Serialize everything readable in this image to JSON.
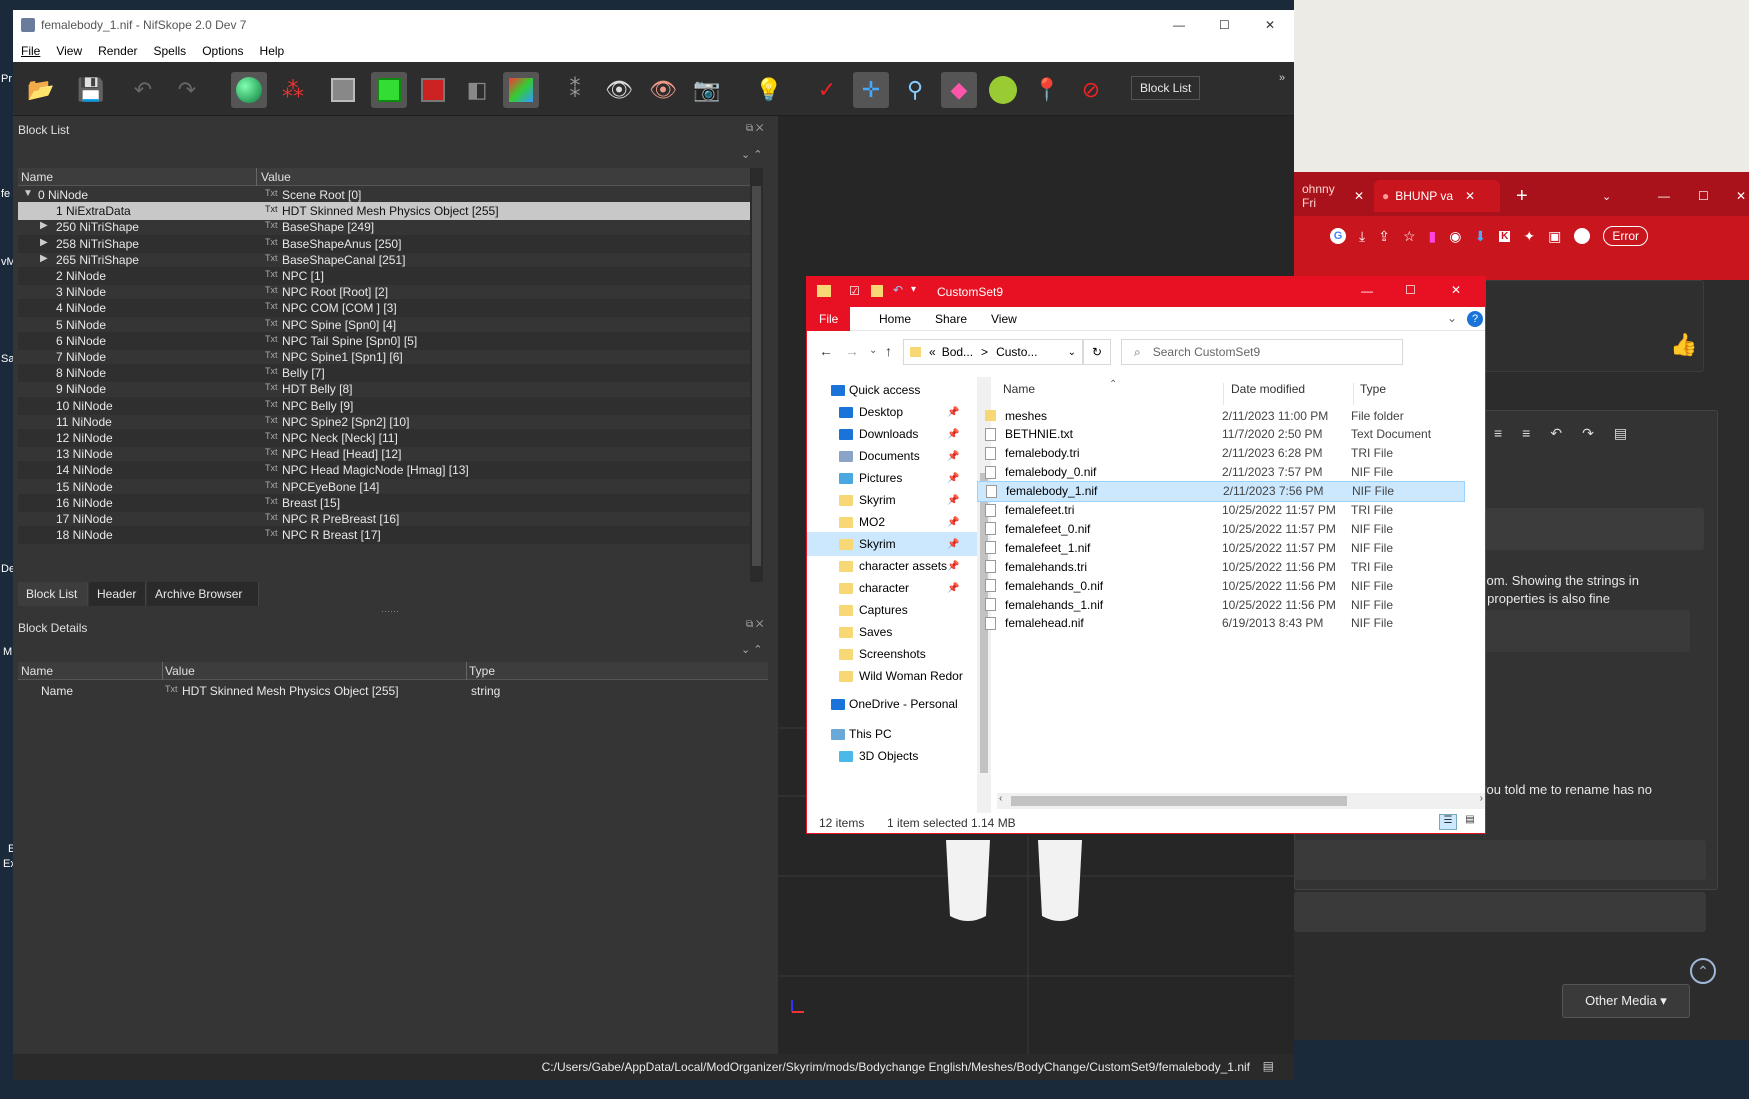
{
  "desktop": {
    "labels": [
      "Pr",
      "fe",
      "vM",
      "Sa",
      "De",
      "M",
      "E",
      "Ex"
    ]
  },
  "browser": {
    "tabs": [
      "ohnny Fri",
      "BHUNP va"
    ],
    "error_label": "Error",
    "text1_line1": "ndom. Showing the strings in",
    "text1_line2": "ar properties is also fine",
    "text2": "you told me to rename has no",
    "other_media": "Other Media ▾"
  },
  "nifskope": {
    "title": "femalebody_1.nif - NifSkope 2.0 Dev 7",
    "menu": [
      "File",
      "View",
      "Render",
      "Spells",
      "Options",
      "Help"
    ],
    "block_list_button": "Block List",
    "block_list_title": "Block List",
    "columns": {
      "name": "Name",
      "value": "Value"
    },
    "rows": [
      {
        "name": "0 NiNode",
        "value": "Scene Root [0]",
        "indent": 0,
        "arrow": "down"
      },
      {
        "name": "1 NiExtraData",
        "value": "HDT Skinned Mesh Physics Object [255]",
        "indent": 1,
        "arrow": "",
        "selected": true,
        "tag": "Txt"
      },
      {
        "name": "250 NiTriShape",
        "value": "BaseShape [249]",
        "indent": 1,
        "arrow": "right"
      },
      {
        "name": "258 NiTriShape",
        "value": "BaseShapeAnus [250]",
        "indent": 1,
        "arrow": "right"
      },
      {
        "name": "265 NiTriShape",
        "value": "BaseShapeCanal [251]",
        "indent": 1,
        "arrow": "right"
      },
      {
        "name": "2 NiNode",
        "value": "NPC [1]",
        "indent": 1,
        "arrow": ""
      },
      {
        "name": "3 NiNode",
        "value": "NPC Root [Root] [2]",
        "indent": 1,
        "arrow": ""
      },
      {
        "name": "4 NiNode",
        "value": "NPC COM [COM ] [3]",
        "indent": 1,
        "arrow": ""
      },
      {
        "name": "5 NiNode",
        "value": "NPC Spine [Spn0] [4]",
        "indent": 1,
        "arrow": ""
      },
      {
        "name": "6 NiNode",
        "value": "NPC Tail Spine [Spn0] [5]",
        "indent": 1,
        "arrow": ""
      },
      {
        "name": "7 NiNode",
        "value": "NPC Spine1 [Spn1] [6]",
        "indent": 1,
        "arrow": ""
      },
      {
        "name": "8 NiNode",
        "value": "Belly [7]",
        "indent": 1,
        "arrow": ""
      },
      {
        "name": "9 NiNode",
        "value": "HDT Belly [8]",
        "indent": 1,
        "arrow": ""
      },
      {
        "name": "10 NiNode",
        "value": "NPC Belly [9]",
        "indent": 1,
        "arrow": ""
      },
      {
        "name": "11 NiNode",
        "value": "NPC Spine2 [Spn2] [10]",
        "indent": 1,
        "arrow": ""
      },
      {
        "name": "12 NiNode",
        "value": "NPC Neck [Neck] [11]",
        "indent": 1,
        "arrow": ""
      },
      {
        "name": "13 NiNode",
        "value": "NPC Head [Head] [12]",
        "indent": 1,
        "arrow": ""
      },
      {
        "name": "14 NiNode",
        "value": "NPC Head MagicNode [Hmag] [13]",
        "indent": 1,
        "arrow": ""
      },
      {
        "name": "15 NiNode",
        "value": "NPCEyeBone [14]",
        "indent": 1,
        "arrow": ""
      },
      {
        "name": "16 NiNode",
        "value": "Breast [15]",
        "indent": 1,
        "arrow": ""
      },
      {
        "name": "17 NiNode",
        "value": "NPC R PreBreast [16]",
        "indent": 1,
        "arrow": ""
      },
      {
        "name": "18 NiNode",
        "value": "NPC R Breast [17]",
        "indent": 1,
        "arrow": ""
      }
    ],
    "row_tag": "Txt",
    "bottom_tabs": [
      "Block List",
      "Header",
      "Archive Browser"
    ],
    "block_details_title": "Block Details",
    "details_columns": {
      "name": "Name",
      "value": "Value",
      "type": "Type"
    },
    "details_row": {
      "name": "Name",
      "value": "HDT Skinned Mesh Physics Object [255]",
      "type": "string"
    },
    "status_path": "C:/Users/Gabe/AppData/Local/ModOrganizer/Skyrim/mods/Bodychange English/Meshes/BodyChange/CustomSet9/femalebody_1.nif"
  },
  "explorer": {
    "title": "CustomSet9",
    "ribbon": [
      "File",
      "Home",
      "Share",
      "View"
    ],
    "breadcrumb": [
      "«",
      "Bod...",
      ">",
      "Custo..."
    ],
    "search_placeholder": "Search CustomSet9",
    "nav": [
      {
        "label": "Quick access",
        "icon": "star",
        "pin": false,
        "level": 0
      },
      {
        "label": "Desktop",
        "icon": "desktop",
        "pin": true,
        "level": 1
      },
      {
        "label": "Downloads",
        "icon": "download",
        "pin": true,
        "level": 1
      },
      {
        "label": "Documents",
        "icon": "documents",
        "pin": true,
        "level": 1
      },
      {
        "label": "Pictures",
        "icon": "pictures",
        "pin": true,
        "level": 1
      },
      {
        "label": "Skyrim",
        "icon": "folder",
        "pin": true,
        "level": 1
      },
      {
        "label": "MO2",
        "icon": "folder",
        "pin": true,
        "level": 1
      },
      {
        "label": "Skyrim",
        "icon": "folder",
        "pin": true,
        "level": 1,
        "selected": true
      },
      {
        "label": "character assets",
        "icon": "folder",
        "pin": true,
        "level": 1
      },
      {
        "label": "character",
        "icon": "folder",
        "pin": true,
        "level": 1
      },
      {
        "label": "Captures",
        "icon": "folder",
        "pin": false,
        "level": 1
      },
      {
        "label": "Saves",
        "icon": "folder",
        "pin": false,
        "level": 1
      },
      {
        "label": "Screenshots",
        "icon": "folder",
        "pin": false,
        "level": 1
      },
      {
        "label": "Wild Woman Redor",
        "icon": "folder",
        "pin": false,
        "level": 1
      },
      {
        "label": "OneDrive - Personal",
        "icon": "cloud",
        "pin": false,
        "level": 0
      },
      {
        "label": "This PC",
        "icon": "pc",
        "pin": false,
        "level": 0
      },
      {
        "label": "3D Objects",
        "icon": "cube",
        "pin": false,
        "level": 1
      }
    ],
    "columns": {
      "name": "Name",
      "date": "Date modified",
      "type": "Type"
    },
    "files": [
      {
        "name": "meshes",
        "date": "2/11/2023 11:00 PM",
        "type": "File folder",
        "kind": "folder"
      },
      {
        "name": "BETHNIE.txt",
        "date": "11/7/2020 2:50 PM",
        "type": "Text Document",
        "kind": "txt"
      },
      {
        "name": "femalebody.tri",
        "date": "2/11/2023 6:28 PM",
        "type": "TRI File",
        "kind": "file"
      },
      {
        "name": "femalebody_0.nif",
        "date": "2/11/2023 7:57 PM",
        "type": "NIF File",
        "kind": "file"
      },
      {
        "name": "femalebody_1.nif",
        "date": "2/11/2023 7:56 PM",
        "type": "NIF File",
        "kind": "file",
        "selected": true
      },
      {
        "name": "femalefeet.tri",
        "date": "10/25/2022 11:57 PM",
        "type": "TRI File",
        "kind": "file"
      },
      {
        "name": "femalefeet_0.nif",
        "date": "10/25/2022 11:57 PM",
        "type": "NIF File",
        "kind": "file"
      },
      {
        "name": "femalefeet_1.nif",
        "date": "10/25/2022 11:57 PM",
        "type": "NIF File",
        "kind": "file"
      },
      {
        "name": "femalehands.tri",
        "date": "10/25/2022 11:56 PM",
        "type": "TRI File",
        "kind": "file"
      },
      {
        "name": "femalehands_0.nif",
        "date": "10/25/2022 11:56 PM",
        "type": "NIF File",
        "kind": "file"
      },
      {
        "name": "femalehands_1.nif",
        "date": "10/25/2022 11:56 PM",
        "type": "NIF File",
        "kind": "file"
      },
      {
        "name": "femalehead.nif",
        "date": "6/19/2013 8:43 PM",
        "type": "NIF File",
        "kind": "file"
      }
    ],
    "status": {
      "items": "12 items",
      "selected": "1 item selected",
      "size": "1.14 MB"
    }
  },
  "colors": {
    "explorer_accent": "#e81123",
    "chrome_red": "#c9161e",
    "nif_bg": "#353535",
    "selection": "#cce8ff"
  }
}
